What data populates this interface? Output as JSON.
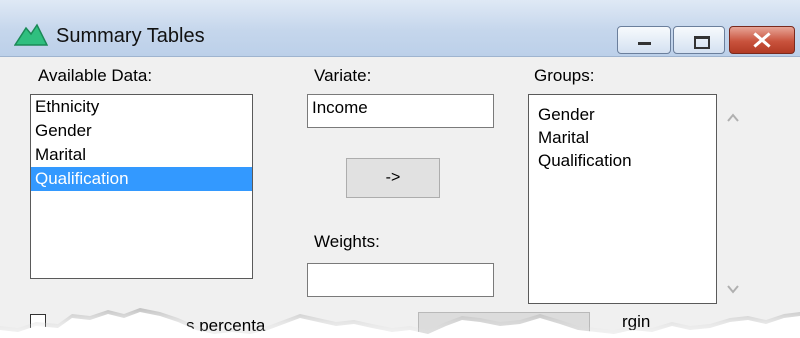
{
  "window": {
    "title": "Summary Tables",
    "controls": {
      "minimize": "minimize",
      "maximize": "maximize",
      "close": "close"
    }
  },
  "available_data": {
    "label": "Available Data:",
    "items": [
      "Ethnicity",
      "Gender",
      "Marital",
      "Qualification"
    ],
    "selected": "Qualification"
  },
  "variate": {
    "label": "Variate:",
    "value": "Income"
  },
  "move_button": {
    "label": "->"
  },
  "weights": {
    "label": "Weights:",
    "value": ""
  },
  "groups": {
    "label": "Groups:",
    "items": [
      "Gender",
      "Marital",
      "Qualification"
    ]
  },
  "torn_bottom": {
    "checkbox_label_fragment": "s percenta",
    "margin_label_fragment": "rgin"
  },
  "colors": {
    "selection": "#3399ff",
    "titlebar": "#c5d6ec",
    "close_button": "#c9533d",
    "app_icon": "#2fbf7f"
  },
  "icons": {
    "app": "app-icon",
    "scroll_up": "chevron-up-icon",
    "scroll_down": "chevron-down-icon"
  }
}
